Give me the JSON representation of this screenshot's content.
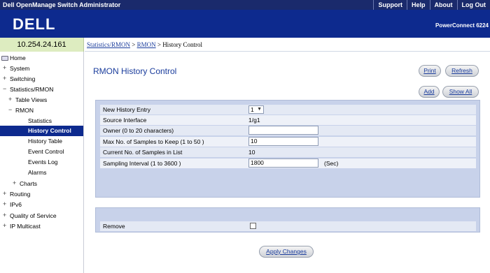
{
  "topbar": {
    "title": "Dell OpenManage Switch Administrator",
    "links": [
      "Support",
      "Help",
      "About",
      "Log Out"
    ]
  },
  "header": {
    "logo": "DELL",
    "product": "PowerConnect 6224"
  },
  "ip_address": "10.254.24.161",
  "breadcrumb": {
    "items": [
      "Statistics/RMON",
      "RMON",
      "History Control"
    ],
    "separator": ">"
  },
  "sidebar": {
    "items": [
      {
        "label": "Home",
        "icon": "folder-icon"
      },
      {
        "label": "System",
        "icon": "plus-icon"
      },
      {
        "label": "Switching",
        "icon": "plus-icon"
      },
      {
        "label": "Statistics/RMON",
        "icon": "minus-icon"
      },
      {
        "label": "Table Views",
        "icon": "plus-icon"
      },
      {
        "label": "RMON",
        "icon": "minus-icon"
      },
      {
        "label": "Statistics",
        "icon": ""
      },
      {
        "label": "History Control",
        "icon": ""
      },
      {
        "label": "History Table",
        "icon": ""
      },
      {
        "label": "Event Control",
        "icon": ""
      },
      {
        "label": "Events Log",
        "icon": ""
      },
      {
        "label": "Alarms",
        "icon": ""
      },
      {
        "label": "Charts",
        "icon": "plus-icon"
      },
      {
        "label": "Routing",
        "icon": "plus-icon"
      },
      {
        "label": "IPv6",
        "icon": "plus-icon"
      },
      {
        "label": "Quality of Service",
        "icon": "plus-icon"
      },
      {
        "label": "IP Multicast",
        "icon": "plus-icon"
      }
    ],
    "selected": "History Control"
  },
  "main": {
    "title": "RMON History Control",
    "buttons": {
      "print": "Print",
      "refresh": "Refresh",
      "add": "Add",
      "show_all": "Show All",
      "apply": "Apply Changes"
    },
    "form": {
      "new_history_entry_label": "New History Entry",
      "new_history_entry_value": "1",
      "source_interface_label": "Source Interface",
      "source_interface_value": "1/g1",
      "owner_label": "Owner (0 to 20 characters)",
      "owner_value": "",
      "max_samples_label": "Max No. of Samples to Keep (1 to 50 )",
      "max_samples_value": "10",
      "current_samples_label": "Current No. of Samples in List",
      "current_samples_value": "10",
      "sampling_interval_label": "Sampling Interval (1 to 3600 )",
      "sampling_interval_value": "1800",
      "sampling_interval_unit": "(Sec)",
      "remove_label": "Remove",
      "remove_checked": false
    }
  },
  "colors": {
    "topbar": "#1a2a6c",
    "header": "#0d2a8e",
    "link": "#1a3c9c",
    "panel": "#c8d2ea",
    "ip_bar": "#ddecc0"
  }
}
